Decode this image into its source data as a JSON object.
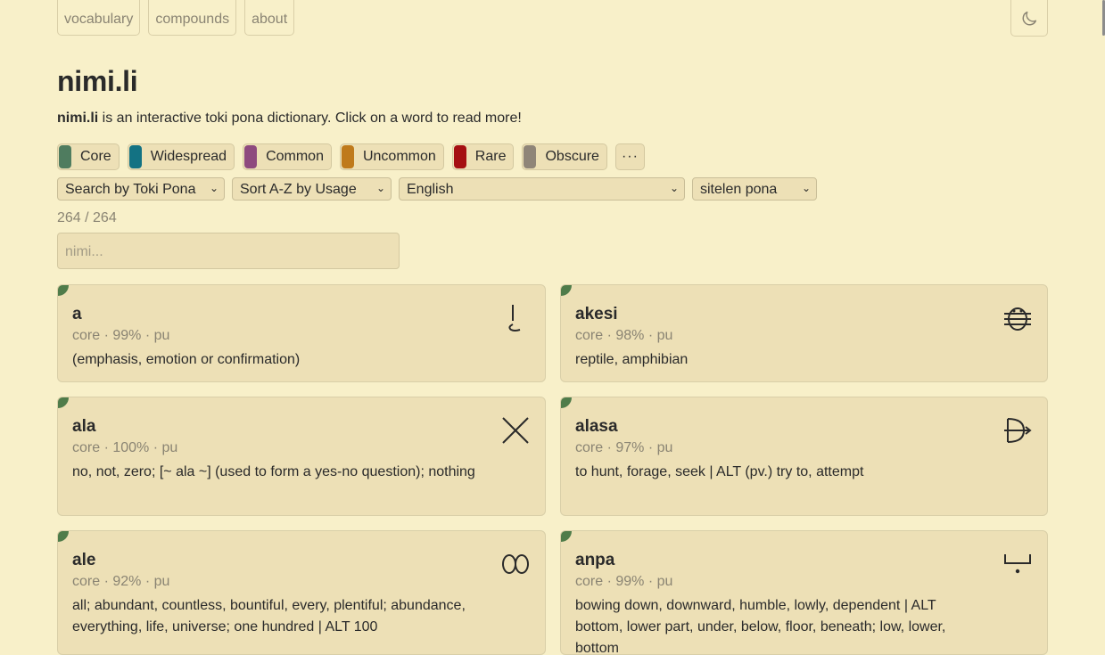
{
  "nav": {
    "items": [
      "vocabulary",
      "compounds",
      "about"
    ]
  },
  "header": {
    "title": "nimi.li",
    "intro_bold": "nimi.li",
    "intro_rest": " is an interactive toki pona dictionary. Click on a word to read more!"
  },
  "filters": [
    {
      "label": "Core",
      "color": "#4f7c5f"
    },
    {
      "label": "Widespread",
      "color": "#137283"
    },
    {
      "label": "Common",
      "color": "#8e4a7e"
    },
    {
      "label": "Uncommon",
      "color": "#bf7a1b"
    },
    {
      "label": "Rare",
      "color": "#a50f12"
    },
    {
      "label": "Obscure",
      "color": "#8f8578"
    }
  ],
  "more_label": "···",
  "selects": {
    "search_by": "Search by Toki Pona",
    "sort": "Sort A-Z by Usage",
    "language": "English",
    "script": "sitelen pona"
  },
  "count": "264 / 264",
  "search": {
    "placeholder": "nimi..."
  },
  "words": [
    {
      "word": "a",
      "meta": "core · 99% · pu",
      "def": "(emphasis, emotion or confirmation)",
      "glyph": "a-glyph-icon"
    },
    {
      "word": "akesi",
      "meta": "core · 98% · pu",
      "def": "reptile, amphibian",
      "glyph": "akesi-glyph-icon"
    },
    {
      "word": "ala",
      "meta": "core · 100% · pu",
      "def": "no, not, zero; [~ ala ~] (used to form a yes-no question); nothing",
      "glyph": "ala-glyph-icon"
    },
    {
      "word": "alasa",
      "meta": "core · 97% · pu",
      "def": "to hunt, forage, seek | ALT (pv.) try to, attempt",
      "glyph": "alasa-glyph-icon"
    },
    {
      "word": "ale",
      "meta": "core · 92% · pu",
      "def": "all; abundant, countless, bountiful, every, plentiful; abundance, everything, life, universe; one hundred | ALT 100",
      "glyph": "ale-glyph-icon"
    },
    {
      "word": "anpa",
      "meta": "core · 99% · pu",
      "def": "bowing down, downward, humble, lowly, dependent | ALT bottom, lower part, under, below, floor, beneath; low, lower, bottom",
      "glyph": "anpa-glyph-icon"
    }
  ]
}
